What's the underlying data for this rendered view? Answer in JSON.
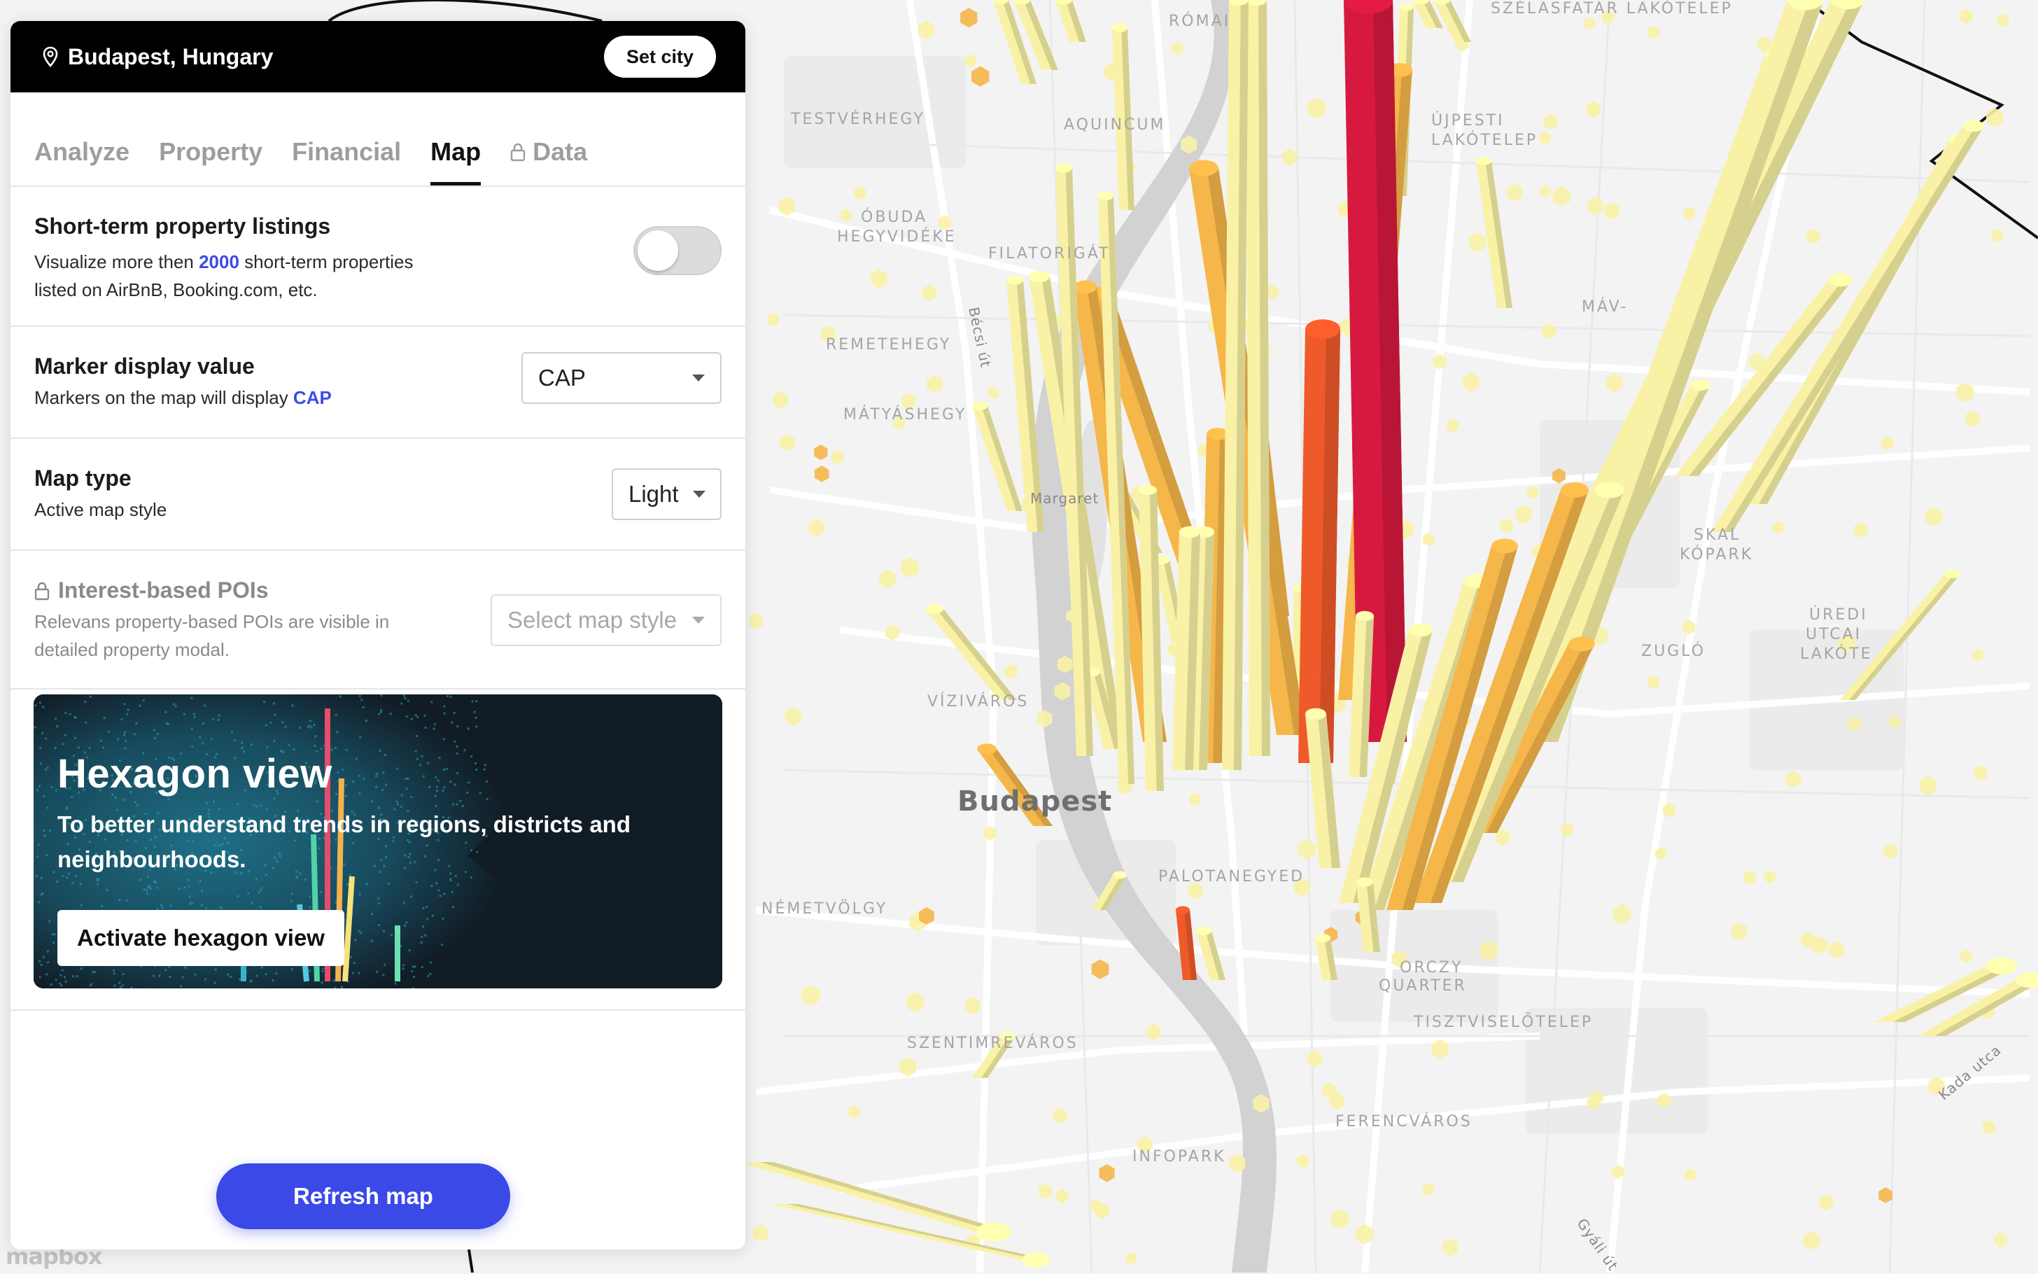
{
  "header": {
    "location": "Budapest, Hungary",
    "set_city_label": "Set city"
  },
  "tabs": [
    {
      "label": "Analyze",
      "active": false,
      "locked": false
    },
    {
      "label": "Property",
      "active": false,
      "locked": false
    },
    {
      "label": "Financial",
      "active": false,
      "locked": false
    },
    {
      "label": "Map",
      "active": true,
      "locked": false
    },
    {
      "label": "Data",
      "active": false,
      "locked": true
    }
  ],
  "short_term": {
    "title": "Short-term property listings",
    "desc_before": "Visualize more then ",
    "count": "2000",
    "desc_after": " short-term properties",
    "desc_line2": "listed on AirBnB, Booking.com, etc.",
    "toggle_on": false
  },
  "marker": {
    "title": "Marker display value",
    "desc_before": "Markers on the map will display ",
    "value_highlight": "CAP",
    "selected": "CAP"
  },
  "map_type": {
    "title": "Map type",
    "desc": "Active map style",
    "selected": "Light"
  },
  "poi": {
    "title": "Interest-based POIs",
    "desc_line1": "Relevans property-based POIs are visible in",
    "desc_line2": "detailed property modal.",
    "placeholder": "Select map style",
    "locked": true
  },
  "promo": {
    "title": "Hexagon view",
    "desc": "To better understand trends in regions, districts and neighbourhoods.",
    "button": "Activate hexagon view"
  },
  "refresh_label": "Refresh map",
  "map": {
    "labels": [
      "RÓMAI",
      "SZÉLASFATAR LAKÓTELEP",
      "TESTVÉRHEGY",
      "AQUINCUM",
      "ÚJPESTI",
      "LAKÓTELEP",
      "ÓBUDA",
      "HEGYVIDÉKE",
      "FILATORIGÁT",
      "REMETEHEGY",
      "MÁTYÁSHEGY",
      "Margaret",
      "Bécsi út",
      "MÁV-",
      "SKAL",
      "KÓPARK",
      "ZUGLÓ",
      "ÚREDI",
      "UTCAI",
      "LAKÓTE",
      "VÍZIVÁROS",
      "Budapest",
      "PALOTANEGYED",
      "NÉMETVÖLGY",
      "ORCZY",
      "QUARTER",
      "TISZTVISELŐTELEP",
      "SZENTIMREVÁROS",
      "FERENCVÁROS",
      "INFOPARK",
      "Kada utca",
      "Gyáli út",
      "mapbox"
    ],
    "colors": {
      "low": "#f9f2a6",
      "mid": "#f5b64a",
      "high": "#ef5a2a",
      "max": "#d7193f"
    }
  }
}
